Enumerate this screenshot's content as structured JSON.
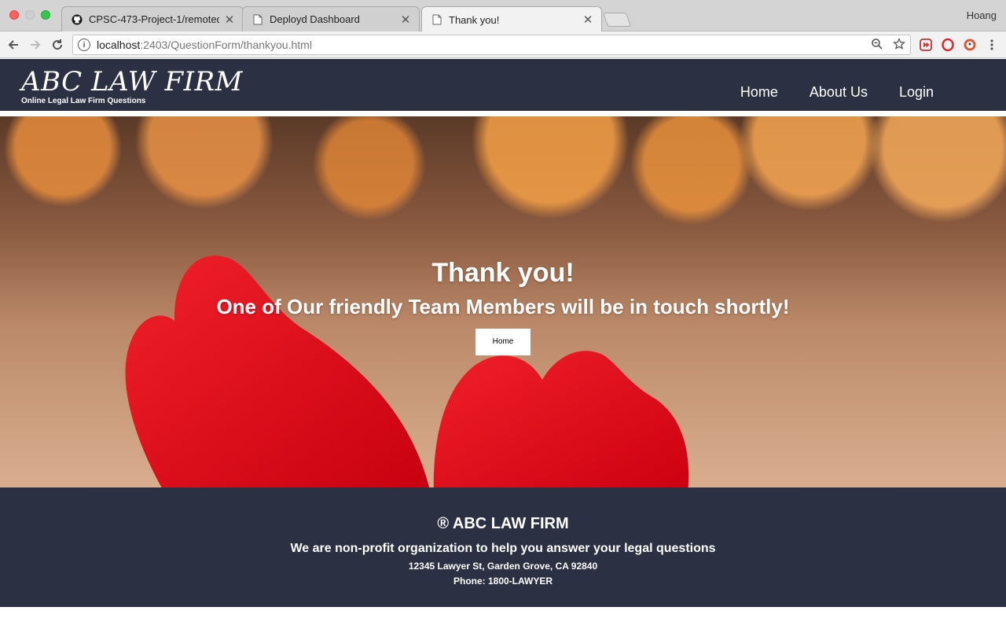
{
  "browser": {
    "tabs": [
      {
        "title": "CPSC-473-Project-1/remoted",
        "icon": "github-icon",
        "active": false
      },
      {
        "title": "Deployd Dashboard",
        "icon": "document-icon",
        "active": false
      },
      {
        "title": "Thank you!",
        "icon": "document-icon",
        "active": true
      }
    ],
    "profile_name": "Hoang",
    "url_host": "localhost",
    "url_rest": ":2403/QuestionForm/thankyou.html"
  },
  "site": {
    "brand": "ABC LAW FIRM",
    "tagline": "Online Legal Law Firm Questions",
    "nav": [
      "Home",
      "About Us",
      "Login"
    ]
  },
  "hero": {
    "title": "Thank you!",
    "subtitle": "One of Our friendly Team Members will be in touch shortly!",
    "button_label": "Home"
  },
  "footer": {
    "title": "® ABC LAW FIRM",
    "description": "We are non-profit organization to help you answer your legal questions",
    "address": "12345 Lawyer St, Garden Grove, CA 92840",
    "phone": "Phone: 1800-LAWYER"
  },
  "colors": {
    "header_bg": "#2b3043",
    "heart_red": "#e0101c"
  }
}
